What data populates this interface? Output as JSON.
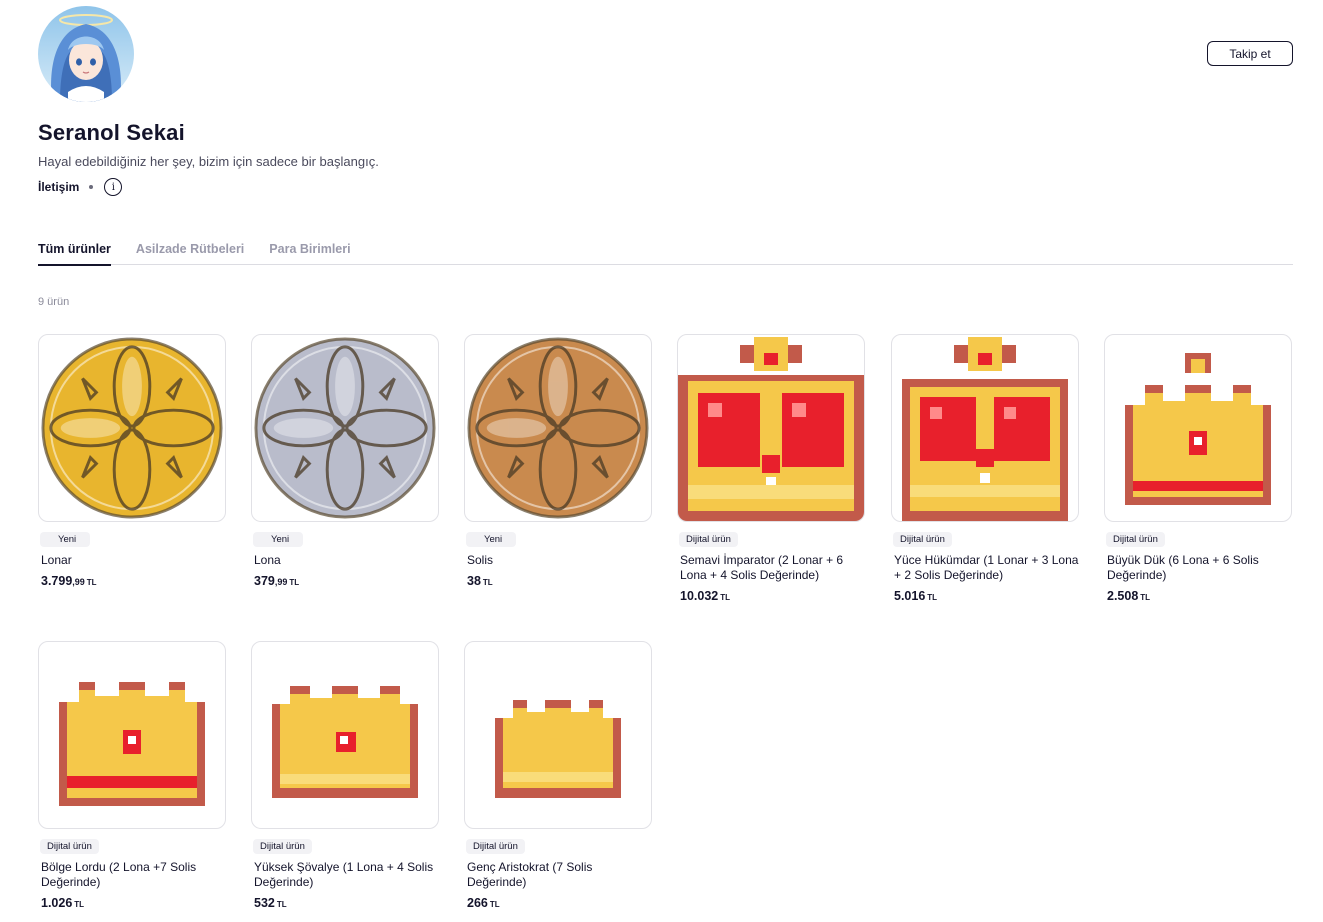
{
  "shop": {
    "name": "Seranol Sekai",
    "tagline": "Hayal edebildiğiniz her şey, bizim için sadece bir başlangıç.",
    "contact_label": "İletişim",
    "follow_label": "Takip et"
  },
  "tabs": [
    {
      "label": "Tüm ürünler",
      "active": true
    },
    {
      "label": "Asilzade Rütbeleri",
      "active": false
    },
    {
      "label": "Para Birimleri",
      "active": false
    }
  ],
  "product_count": "9 ürün",
  "products": [
    {
      "badge": "Yeni",
      "title": "Lonar",
      "price_main": "3.799",
      "price_dec": ",99",
      "currency": "TL",
      "image": "gold-coin-icon"
    },
    {
      "badge": "Yeni",
      "title": "Lona",
      "price_main": "379",
      "price_dec": ",99",
      "currency": "TL",
      "image": "silver-coin-icon"
    },
    {
      "badge": "Yeni",
      "title": "Solis",
      "price_main": "38",
      "price_dec": "",
      "currency": "TL",
      "image": "bronze-coin-icon"
    },
    {
      "badge": "Dijital ürün",
      "title": "Semavi İmparator (2 Lonar + 6 Lona + 4 Solis Değerinde)",
      "price_main": "10.032",
      "price_dec": "",
      "currency": "TL",
      "image": "imperial-crown-icon"
    },
    {
      "badge": "Dijital ürün",
      "title": "Yüce Hükümdar (1 Lonar + 3 Lona + 2 Solis Değerinde)",
      "price_main": "5.016",
      "price_dec": "",
      "currency": "TL",
      "image": "royal-crown-icon"
    },
    {
      "badge": "Dijital ürün",
      "title": "Büyük Dük (6 Lona + 6 Solis Değerinde)",
      "price_main": "2.508",
      "price_dec": "",
      "currency": "TL",
      "image": "duke-crown-icon"
    },
    {
      "badge": "Dijital ürün",
      "title": "Bölge Lordu (2 Lona +7 Solis Değerinde)",
      "price_main": "1.026",
      "price_dec": "",
      "currency": "TL",
      "image": "lord-crown-icon"
    },
    {
      "badge": "Dijital ürün",
      "title": "Yüksek Şövalye (1 Lona + 4 Solis Değerinde)",
      "price_main": "532",
      "price_dec": "",
      "currency": "TL",
      "image": "knight-crown-icon"
    },
    {
      "badge": "Dijital ürün",
      "title": "Genç Aristokrat (7 Solis Değerinde)",
      "price_main": "266",
      "price_dec": "",
      "currency": "TL",
      "image": "aristocrat-crown-icon"
    }
  ],
  "colors": {
    "gold": "#e8b52e",
    "silver": "#b9bccb",
    "bronze": "#c98a4e",
    "crown_red": "#e8202c",
    "crown_gold": "#f5c84a",
    "crown_outline": "#c25a4a"
  }
}
